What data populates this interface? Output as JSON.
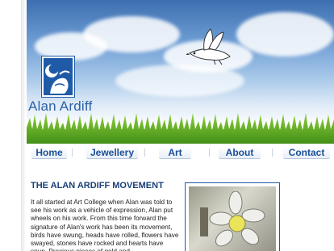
{
  "brand": {
    "name": "Alan Ardiff"
  },
  "nav": {
    "items": [
      {
        "label": "Home"
      },
      {
        "label": "Jewellery"
      },
      {
        "label": "Art"
      },
      {
        "label": "About"
      },
      {
        "label": "Contact"
      }
    ]
  },
  "article": {
    "heading": "THE ALAN ARDIFF MOVEMENT",
    "body": "It all started at Art College when Alan was told to see his work as a vehicle of expression, Alan put wheels on his work. From this time forward the signature of Alan's work has been its movement, birds have swung, heads have rolled, flowers have swayed, stones have rocked and hearts have spun. Precious pieces of gold and"
  },
  "colors": {
    "accent": "#1f5aa6",
    "nav_text": "#1a4f96",
    "heading": "#1a3f7a"
  },
  "icons": {
    "logo": "moon-face-logo-icon",
    "bird": "flying-bird-icon"
  }
}
